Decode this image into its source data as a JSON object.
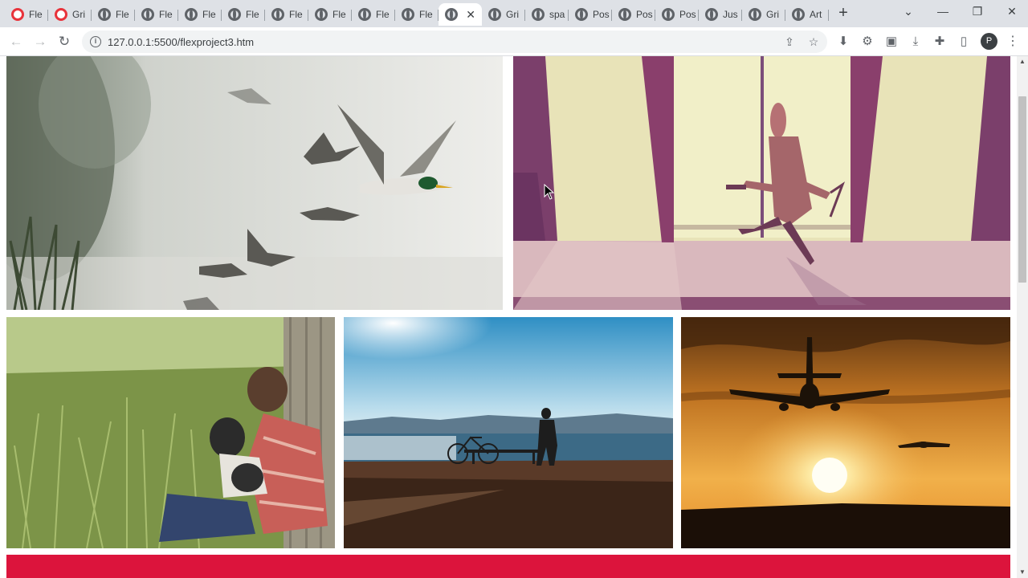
{
  "browser": {
    "tabs": [
      {
        "title": "Fle",
        "icon": "opera-icon"
      },
      {
        "title": "Gri",
        "icon": "opera-icon"
      },
      {
        "title": "Fle",
        "icon": "globe-icon"
      },
      {
        "title": "Fle",
        "icon": "globe-icon"
      },
      {
        "title": "Fle",
        "icon": "globe-icon"
      },
      {
        "title": "Fle",
        "icon": "globe-icon"
      },
      {
        "title": "Fle",
        "icon": "globe-icon"
      },
      {
        "title": "Fle",
        "icon": "globe-icon"
      },
      {
        "title": "Fle",
        "icon": "globe-icon"
      },
      {
        "title": "Fle",
        "icon": "globe-icon"
      },
      {
        "title": "",
        "icon": "globe-icon",
        "active": true
      },
      {
        "title": "Gri",
        "icon": "globe-icon"
      },
      {
        "title": "spa",
        "icon": "globe-icon"
      },
      {
        "title": "Pos",
        "icon": "globe-icon"
      },
      {
        "title": "Pos",
        "icon": "globe-icon"
      },
      {
        "title": "Pos",
        "icon": "globe-icon"
      },
      {
        "title": "Jus",
        "icon": "globe-icon"
      },
      {
        "title": "Gri",
        "icon": "globe-icon"
      },
      {
        "title": "Art",
        "icon": "globe-icon"
      }
    ],
    "tab_close_glyph": "✕",
    "new_tab_glyph": "+",
    "window_controls": {
      "dropdown": "⌄",
      "minimize": "—",
      "restore": "❐",
      "close": "✕"
    },
    "url": "127.0.0.1:5500/flexproject3.htm",
    "profile_initial": "P"
  },
  "page": {
    "images": [
      {
        "subject": "mallard ducks flying over misty lake"
      },
      {
        "subject": "illustrated man in trench coat with pistol and cane at glass doors"
      },
      {
        "subject": "man with dog sitting in tall grass"
      },
      {
        "subject": "silhouette of person and bicycle by the sea"
      },
      {
        "subject": "airplanes landing at golden sunset"
      }
    ],
    "colors": {
      "band": "#dc143c",
      "tabstrip": "#dee1e6"
    }
  }
}
